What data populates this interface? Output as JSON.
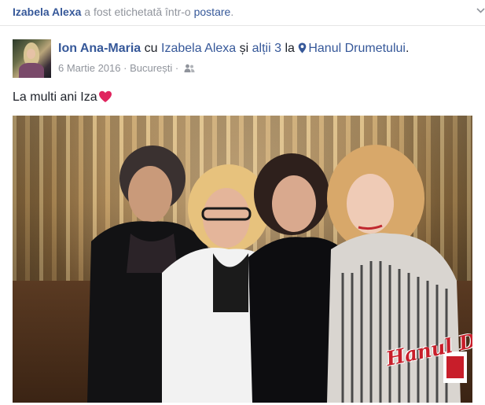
{
  "notification": {
    "actor": "Izabela Alexa",
    "text": " a fost etichetată într-o ",
    "object": "postare",
    "end": "."
  },
  "post": {
    "author": "Ion Ana-Maria",
    "with_word": " cu ",
    "tagged": "Izabela Alexa",
    "and_word": " și ",
    "others": "alții 3",
    "at_word": " la ",
    "place": "Hanul Drumetului",
    "end": ".",
    "date": "6 Martie 2016",
    "sep": " · ",
    "city": "București",
    "sep2": " ·",
    "audience_icon": "friends-icon",
    "message": "La multi ani Iza",
    "message_emoji": "heart-icon",
    "heart_color": "#e0245e"
  },
  "photo": {
    "watermark": "Hanul Dru"
  },
  "colors": {
    "link": "#365899",
    "muted": "#90949c",
    "text": "#1d2129"
  }
}
